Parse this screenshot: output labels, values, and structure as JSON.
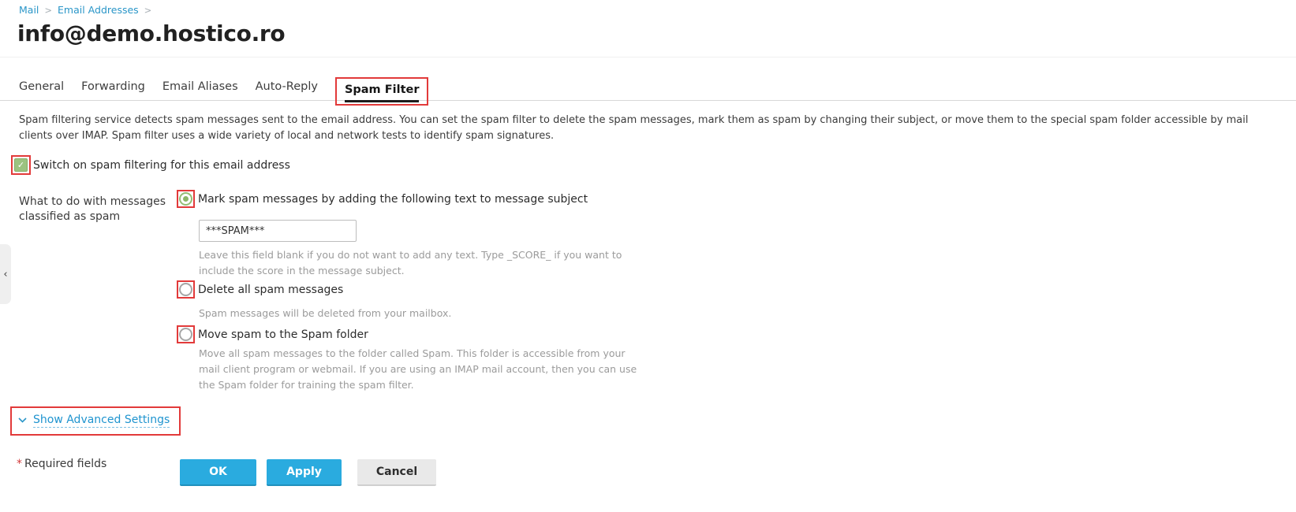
{
  "breadcrumb": {
    "items": [
      {
        "label": "Mail"
      },
      {
        "label": "Email Addresses"
      }
    ],
    "separator": ">"
  },
  "page": {
    "title": "info@demo.hostico.ro"
  },
  "tabs": [
    {
      "label": "General",
      "active": false
    },
    {
      "label": "Forwarding",
      "active": false
    },
    {
      "label": "Email Aliases",
      "active": false
    },
    {
      "label": "Auto-Reply",
      "active": false
    },
    {
      "label": "Spam Filter",
      "active": true
    }
  ],
  "description": "Spam filtering service detects spam messages sent to the email address. You can set the spam filter to delete the spam messages, mark them as spam by changing their subject, or move them to the special spam folder accessible by mail clients over IMAP. Spam filter uses a wide variety of local and network tests to identify spam signatures.",
  "switch_checkbox": {
    "label": "Switch on spam filtering for this email address",
    "checked": true
  },
  "spam_action": {
    "group_label": "What to do with messages classified as spam",
    "options": [
      {
        "label": "Mark spam messages by adding the following text to message subject",
        "selected": true,
        "input_value": "***SPAM***",
        "help": "Leave this field blank if you do not want to add any text. Type _SCORE_ if you want to\ninclude the score in the message subject."
      },
      {
        "label": "Delete all spam messages",
        "selected": false,
        "help": "Spam messages will be deleted from your mailbox."
      },
      {
        "label": "Move spam to the Spam folder",
        "selected": false,
        "help": "Move all spam messages to the folder called Spam. This folder is accessible from your\nmail client program or webmail. If you are using an IMAP mail account, then you can use\nthe Spam folder for training the spam filter."
      }
    ]
  },
  "advanced_link": {
    "label": "Show Advanced Settings"
  },
  "footer": {
    "asterisk": "*",
    "required_note": "Required fields",
    "buttons": [
      {
        "label": "OK"
      },
      {
        "label": "Apply"
      },
      {
        "label": "Cancel"
      }
    ]
  },
  "icons": {
    "check": "✓",
    "collapse_chevron": "‹",
    "chevron_down": "⌄"
  },
  "colors": {
    "annotation_red": "#e23a3a",
    "primary_button_blue": "#2aabdf",
    "link_blue": "#1f94cf",
    "breadcrumb_blue": "#2a96c8",
    "checkbox_green": "#9cc380",
    "active_tab_underline": "#1d1d1d"
  }
}
